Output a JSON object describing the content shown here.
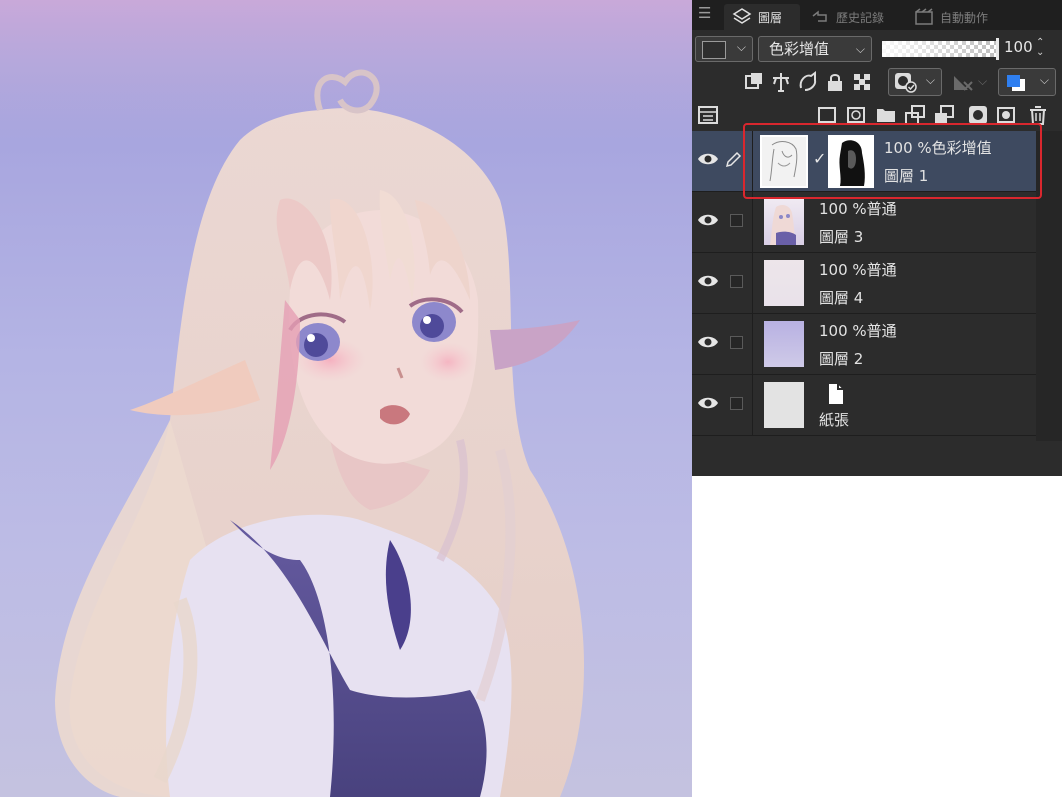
{
  "tabs": [
    {
      "label": "圖層",
      "icon": "layers-icon",
      "active": true
    },
    {
      "label": "歷史記錄",
      "icon": "history-icon",
      "active": false
    },
    {
      "label": "自動動作",
      "icon": "auto-action-icon",
      "active": false
    }
  ],
  "blend_mode": "色彩增值",
  "opacity": {
    "value": "100",
    "level_percent": 100
  },
  "colors": {
    "panel_bg": "#2c2c2c",
    "selected_row": "#3e4a60",
    "highlight_border": "#d9272e",
    "accent_blue": "#2f7ff0"
  },
  "layers": [
    {
      "mode": "100 %色彩增值",
      "name": "圖層 1",
      "selected": true,
      "has_mask": true
    },
    {
      "mode": "100 %普通",
      "name": "圖層 3",
      "selected": false
    },
    {
      "mode": "100 %普通",
      "name": "圖層 4",
      "selected": false
    },
    {
      "mode": "100 %普通",
      "name": "圖層 2",
      "selected": false
    },
    {
      "mode": "",
      "name": "紙張",
      "selected": false,
      "paper": true
    }
  ]
}
